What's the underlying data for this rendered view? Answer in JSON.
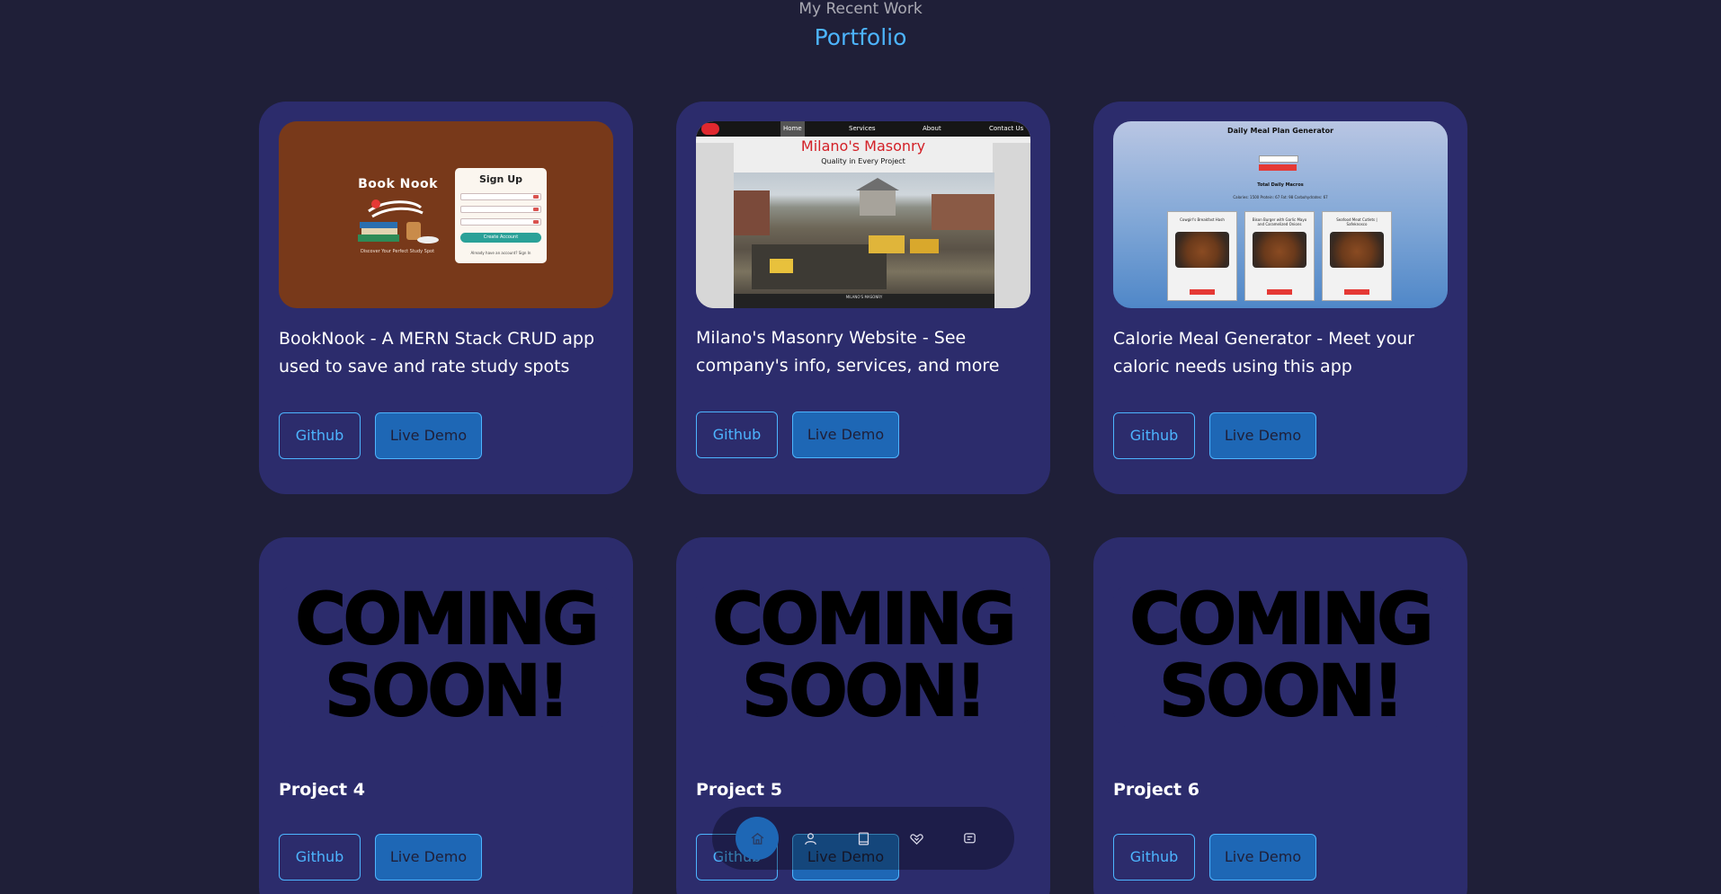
{
  "header": {
    "subtitle": "My Recent Work",
    "title": "Portfolio"
  },
  "projects": [
    {
      "title": "BookNook - A MERN Stack CRUD app used to save and rate study spots",
      "github_label": "Github",
      "demo_label": "Live Demo",
      "preview": {
        "brand": "Book Nook",
        "tagline": "Discover Your Perfect Study Spot",
        "form_title": "Sign Up",
        "button": "Create Account",
        "footer": "Already have an account? Sign In"
      }
    },
    {
      "title": "Milano's Masonry Website - See company's info, services, and more",
      "github_label": "Github",
      "demo_label": "Live Demo",
      "preview": {
        "nav": [
          "Home",
          "Services",
          "About",
          "Contact Us"
        ],
        "name": "Milano's Masonry",
        "tagline": "Quality in Every Project",
        "footer": "MILANO'S MASONRY"
      }
    },
    {
      "title": "Calorie Meal Generator - Meet your caloric needs using this app",
      "github_label": "Github",
      "demo_label": "Live Demo",
      "preview": {
        "heading": "Daily Meal Plan Generator",
        "totals_heading": "Total Daily Macros",
        "stats": "Calories: 1500   Protein: 67   Fat: 98   Carbohydrates: 67",
        "meals": [
          "Cowgirl's Breakfast Hash",
          "Bison Burger with Garlic Mayo and Caramelized Onions",
          "Seafood Meat Cutlets | Safeknosco"
        ]
      }
    },
    {
      "title": "Project 4",
      "github_label": "Github",
      "demo_label": "Live Demo",
      "preview": {
        "text": "COMING SOON!"
      }
    },
    {
      "title": "Project 5",
      "github_label": "Github",
      "demo_label": "Live Demo",
      "preview": {
        "text": "COMING SOON!"
      }
    },
    {
      "title": "Project 6",
      "github_label": "Github",
      "demo_label": "Live Demo",
      "preview": {
        "text": "COMING SOON!"
      }
    }
  ],
  "nav": {
    "items": [
      "home-icon",
      "user-icon",
      "book-icon",
      "handshake-icon",
      "message-icon"
    ],
    "active": "home-icon"
  },
  "colors": {
    "background": "#1f1f38",
    "card": "#2c2c6c",
    "accent": "#4db5ff",
    "primary_button": "#1e67b5"
  }
}
